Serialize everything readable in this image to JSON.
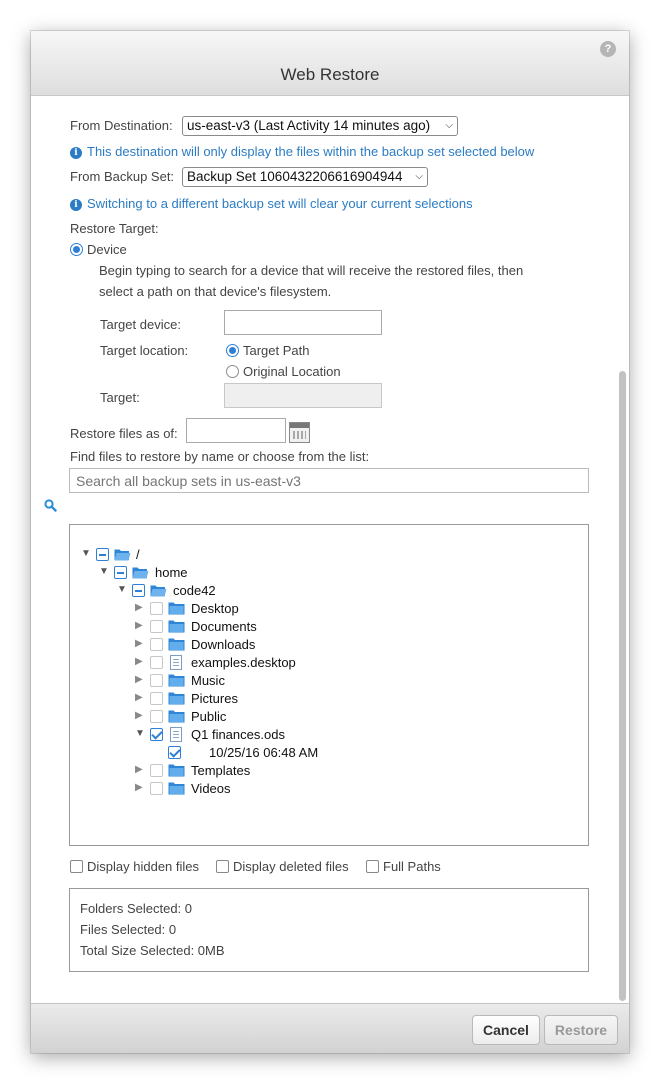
{
  "dialog": {
    "title": "Web Restore",
    "help_glyph": "?"
  },
  "form": {
    "from_destination_label": "From Destination:",
    "destination_value": "us-east-v3 (Last Activity 14 minutes ago)",
    "destination_info": "This destination will only display the files within the backup set selected below",
    "from_backup_set_label": "From Backup Set:",
    "backup_set_value": "Backup Set 1060432206616904944",
    "backup_set_info": "Switching to a different backup set will clear your current selections",
    "restore_target_label": "Restore Target:",
    "device_option_label": "Device",
    "device_help_line1": "Begin typing to search for a device that will receive the restored files, then",
    "device_help_line2": "select a path on that device's filesystem.",
    "target_device_label": "Target device:",
    "target_device_value": "",
    "target_location_label": "Target location:",
    "target_path_option": "Target Path",
    "original_location_option": "Original Location",
    "target_label": "Target:",
    "target_value": "",
    "restore_as_of_label": "Restore files as of:",
    "restore_as_of_value": "",
    "find_files_label": "Find files to restore by name or choose from the list:",
    "search_placeholder": "Search all backup sets in us-east-v3"
  },
  "tree": {
    "root": "/",
    "home": "home",
    "user": "code42",
    "items": [
      {
        "name": "Desktop",
        "type": "folder",
        "checked": false
      },
      {
        "name": "Documents",
        "type": "folder",
        "checked": false
      },
      {
        "name": "Downloads",
        "type": "folder",
        "checked": false
      },
      {
        "name": "examples.desktop",
        "type": "file",
        "checked": false
      },
      {
        "name": "Music",
        "type": "folder",
        "checked": false
      },
      {
        "name": "Pictures",
        "type": "folder",
        "checked": false
      },
      {
        "name": "Public",
        "type": "folder",
        "checked": false
      },
      {
        "name": "Q1 finances.ods",
        "type": "file",
        "checked": true
      },
      {
        "name": "Templates",
        "type": "folder",
        "checked": false
      },
      {
        "name": "Videos",
        "type": "folder",
        "checked": false
      }
    ],
    "version": "10/25/16 06:48 AM"
  },
  "options": {
    "hidden_files": "Display hidden files",
    "deleted_files": "Display deleted files",
    "full_paths": "Full Paths"
  },
  "summary": {
    "folders": "Folders Selected: 0",
    "files": "Files Selected: 0",
    "total_size": "Total Size Selected: 0MB"
  },
  "footer": {
    "cancel_label": "Cancel",
    "restore_label": "Restore"
  },
  "colors": {
    "accent": "#2f7fd6",
    "info_text": "#2b7cc4",
    "folder": "#3a8fd9"
  }
}
